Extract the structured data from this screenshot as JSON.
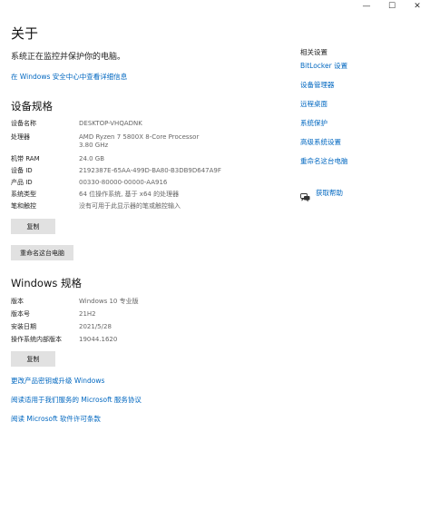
{
  "window": {
    "minimize_glyph": "—",
    "maximize_glyph": "☐",
    "close_glyph": "✕"
  },
  "header": {
    "title": "关于",
    "protect_status": "系统正在监控并保护你的电脑。",
    "security_link": "在 Windows 安全中心中查看详细信息"
  },
  "device_specs": {
    "title": "设备规格",
    "rows": [
      {
        "key": "设备名称",
        "value": "DESKTOP-VHQADNK"
      },
      {
        "key": "处理器",
        "value": "AMD Ryzen 7 5800X 8-Core Processor",
        "value2": "3.80 GHz"
      },
      {
        "key": "机带 RAM",
        "value": "24.0 GB"
      },
      {
        "key": "设备 ID",
        "value": "2192387E-65AA-499D-BA80-B3DB9D647A9F"
      },
      {
        "key": "产品 ID",
        "value": "00330-80000-00000-AA916"
      },
      {
        "key": "系统类型",
        "value": "64 位操作系统, 基于 x64 的处理器"
      },
      {
        "key": "笔和触控",
        "value": "没有可用于此显示器的笔或触控输入"
      }
    ],
    "copy_button": "复制",
    "rename_button": "重命名这台电脑"
  },
  "windows_specs": {
    "title": "Windows 规格",
    "rows": [
      {
        "key": "版本",
        "value": "Windows 10 专业版"
      },
      {
        "key": "版本号",
        "value": "21H2"
      },
      {
        "key": "安装日期",
        "value": "2021/5/28"
      },
      {
        "key": "操作系统内部版本",
        "value": "19044.1620"
      }
    ],
    "copy_button": "复制",
    "links": [
      "更改产品密钥或升级 Windows",
      "阅读适用于我们服务的 Microsoft 服务协议",
      "阅读 Microsoft 软件许可条款"
    ]
  },
  "related": {
    "title": "相关设置",
    "links": [
      "BitLocker 设置",
      "设备管理器",
      "远程桌面",
      "系统保护",
      "高级系统设置",
      "重命名这台电脑"
    ],
    "help_link": "获取帮助",
    "help_icon": "chat-bubble-icon"
  },
  "colors": {
    "link": "#0067c0",
    "button_bg": "#e1e1e1",
    "muted": "#666666"
  }
}
